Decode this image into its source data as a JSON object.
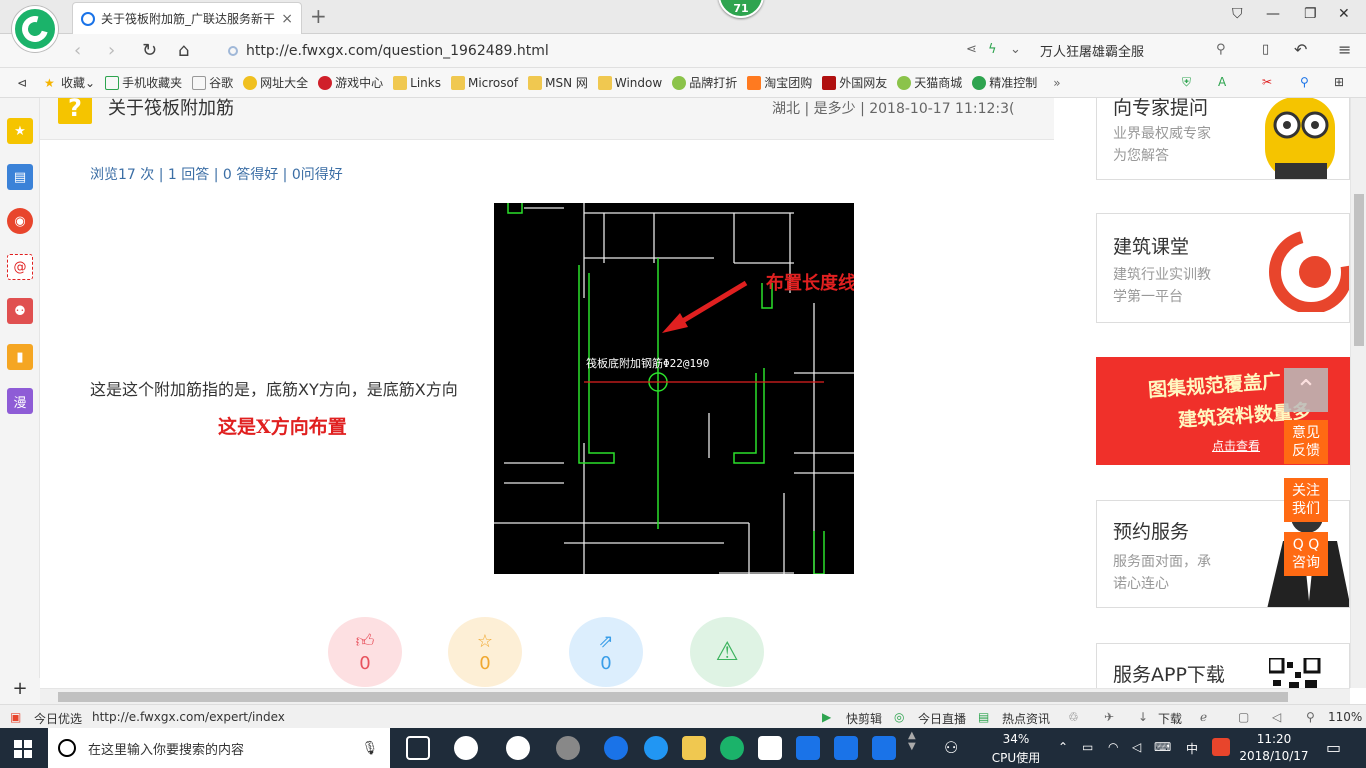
{
  "browser": {
    "tab_title": "关于筏板附加筋_广联达服务新干",
    "tab_close": "×",
    "new_tab": "+",
    "badge": "71",
    "url": "http://e.fwxgx.com/question_1962489.html",
    "search_text": "万人狂屠雄霸全服",
    "bookmarks": [
      "收藏",
      "手机收藏夹",
      "谷歌",
      "网址大全",
      "游戏中心",
      "Links",
      "Microsof",
      "MSN 网",
      "Window",
      "品牌打折",
      "淘宝团购",
      "外国网友",
      "天猫商城",
      "精准控制"
    ]
  },
  "sidebar": {
    "manga_label": "漫"
  },
  "question": {
    "icon_char": "?",
    "title": "关于筏板附加筋",
    "meta": "湖北 | 是多少 | 2018-10-17 11:12:3(",
    "stats": "浏览17 次 | 1 回答 | 0 答得好 | 0问得好",
    "body_text": "这是这个附加筋指的是，底筋XY方向，是底筋X方向",
    "body_red": "这是X方向布置",
    "image_annotation": "布置长度线",
    "image_text": "筏板底附加钢筋Φ22@190",
    "actions": [
      {
        "icon": "thumbs-up",
        "count": "0",
        "color": "#e8525d",
        "bg": "#fde0e2"
      },
      {
        "icon": "star",
        "count": "0",
        "color": "#f0a830",
        "bg": "#fdefd6"
      },
      {
        "icon": "share",
        "count": "0",
        "color": "#3a9ee8",
        "bg": "#dceefd"
      },
      {
        "icon": "warning",
        "count": "",
        "color": "#3cb35e",
        "bg": "#dff3e4"
      }
    ]
  },
  "right": {
    "card1_title": "向专家提问",
    "card1_sub1": "业界最权威专家",
    "card1_sub2": "为您解答",
    "card2_title": "建筑课堂",
    "card2_sub1": "建筑行业实训教",
    "card2_sub2": "学第一平台",
    "banner_line1": "图集规范覆盖广",
    "banner_line2": "建筑资料数量多",
    "banner_link": "点击查看",
    "card3_title": "预约服务",
    "card3_sub1": "服务面对面，承",
    "card3_sub2": "诺心连心",
    "card4_title": "服务APP下载",
    "float_feedback_1": "意见",
    "float_feedback_2": "反馈",
    "float_follow_1": "关注",
    "float_follow_2": "我们",
    "float_qq_1": "Q Q",
    "float_qq_2": "咨询"
  },
  "statusbar": {
    "today": "今日优选",
    "hover_url": "http://e.fwxgx.com/expert/index",
    "kuaijian": "快剪辑",
    "live": "今日直播",
    "news": "热点资讯",
    "download": "下载",
    "zoom": "110%"
  },
  "taskbar": {
    "search_placeholder": "在这里输入你要搜索的内容",
    "cpu_percent": "34%",
    "cpu_label": "CPU使用",
    "ime": "中",
    "time": "11:20",
    "date": "2018/10/17"
  }
}
